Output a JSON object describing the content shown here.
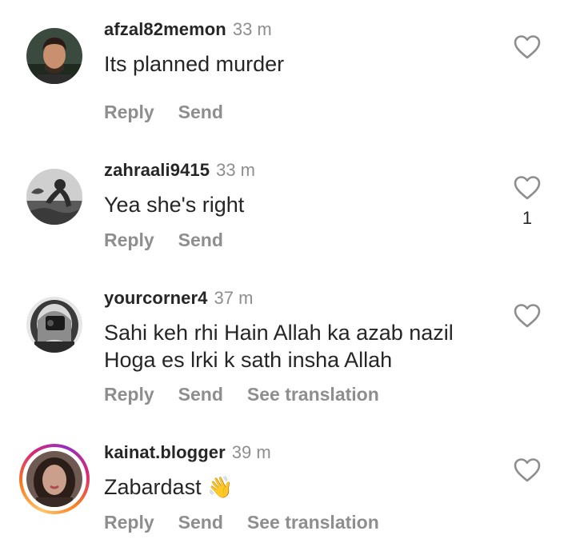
{
  "comments": [
    {
      "username": "afzal82memon",
      "time": "33 m",
      "lines": [
        "Its planned murder"
      ],
      "likes": "",
      "actions": [
        "Reply",
        "Send"
      ],
      "avatar_icon": "profile-photo-man"
    },
    {
      "username": "zahraali9415",
      "time": "33 m",
      "lines": [
        "Yea she's right"
      ],
      "likes": "1",
      "actions": [
        "Reply",
        "Send"
      ],
      "avatar_icon": "profile-photo-bw-figure"
    },
    {
      "username": "yourcorner4",
      "time": "37 m",
      "lines": [
        "Sahi keh rhi Hain Allah ka azab nazil",
        "Hoga es lrki k sath insha Allah"
      ],
      "likes": "",
      "actions": [
        "Reply",
        "Send",
        "See translation"
      ],
      "avatar_icon": "profile-photo-mirror-selfie"
    },
    {
      "username": "kainat.blogger",
      "time": "39 m",
      "lines": [
        "Zabardast"
      ],
      "emoji": "👋",
      "likes": "",
      "actions": [
        "Reply",
        "Send",
        "See translation"
      ],
      "avatar_icon": "profile-photo-woman-story-ring"
    }
  ],
  "colors": {
    "text": "#262626",
    "muted": "#8e8e8e",
    "heart_outline": "#8e8e8e",
    "story_ring_start": "#fdc468",
    "story_ring_end": "#d62976"
  },
  "icons": {
    "like": "heart-outline-icon"
  }
}
